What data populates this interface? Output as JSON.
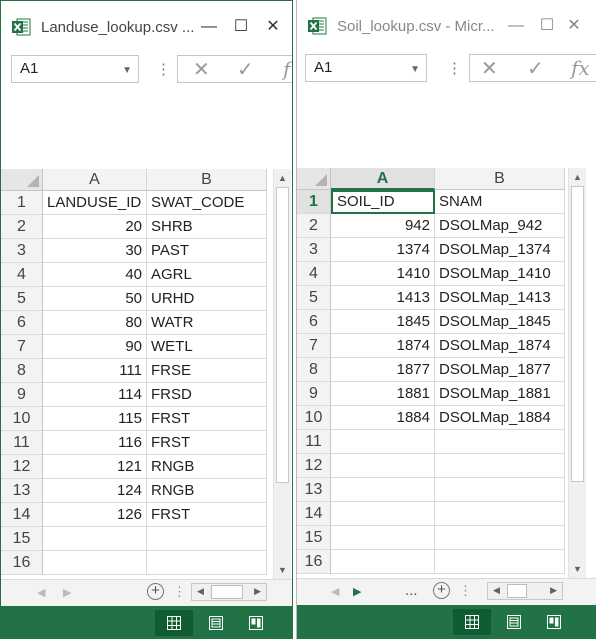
{
  "windows": [
    {
      "title": "Landuse_lookup.csv ...",
      "title_buttons": [
        "—",
        "☐",
        "✕"
      ],
      "namebox": "A1",
      "formula_icons": [
        "cancel-icon",
        "enter-icon",
        "function-icon"
      ],
      "formula_glyphs": [
        "✕",
        "✓",
        "f"
      ],
      "columns": [
        "A",
        "B"
      ],
      "row_numbers": [
        "1",
        "2",
        "3",
        "4",
        "5",
        "6",
        "7",
        "8",
        "9",
        "10",
        "11",
        "12",
        "13",
        "14",
        "15",
        "16"
      ],
      "cells": [
        [
          "LANDUSE_ID",
          "SWAT_CODE"
        ],
        [
          "20",
          "SHRB"
        ],
        [
          "30",
          "PAST"
        ],
        [
          "40",
          "AGRL"
        ],
        [
          "50",
          "URHD"
        ],
        [
          "80",
          "WATR"
        ],
        [
          "90",
          "WETL"
        ],
        [
          "111",
          "FRSE"
        ],
        [
          "114",
          "FRSD"
        ],
        [
          "115",
          "FRST"
        ],
        [
          "116",
          "FRST"
        ],
        [
          "121",
          "RNGB"
        ],
        [
          "124",
          "RNGB"
        ],
        [
          "126",
          "FRST"
        ],
        [
          "",
          ""
        ],
        [
          "",
          ""
        ]
      ],
      "active_cell": "A1",
      "status_views": [
        "normal-view-icon",
        "page-layout-view-icon",
        "page-break-preview-icon"
      ],
      "selected_view": "normal-view-icon"
    },
    {
      "title": "Soil_lookup.csv - Micr...",
      "title_buttons": [
        "—",
        "☐",
        "✕"
      ],
      "namebox": "A1",
      "formula_icons": [
        "cancel-icon",
        "enter-icon",
        "function-icon"
      ],
      "formula_glyphs": [
        "✕",
        "✓",
        "fx"
      ],
      "columns": [
        "A",
        "B"
      ],
      "row_numbers": [
        "1",
        "2",
        "3",
        "4",
        "5",
        "6",
        "7",
        "8",
        "9",
        "10",
        "11",
        "12",
        "13",
        "14",
        "15",
        "16"
      ],
      "cells": [
        [
          "SOIL_ID",
          "SNAM"
        ],
        [
          "942",
          "DSOLMap_942"
        ],
        [
          "1374",
          "DSOLMap_1374"
        ],
        [
          "1410",
          "DSOLMap_1410"
        ],
        [
          "1413",
          "DSOLMap_1413"
        ],
        [
          "1845",
          "DSOLMap_1845"
        ],
        [
          "1874",
          "DSOLMap_1874"
        ],
        [
          "1877",
          "DSOLMap_1877"
        ],
        [
          "1881",
          "DSOLMap_1881"
        ],
        [
          "1884",
          "DSOLMap_1884"
        ],
        [
          "",
          ""
        ],
        [
          "",
          ""
        ],
        [
          "",
          ""
        ],
        [
          "",
          ""
        ],
        [
          "",
          ""
        ],
        [
          "",
          ""
        ]
      ],
      "active_cell": "A1",
      "status_views": [
        "normal-view-icon",
        "page-layout-view-icon",
        "page-break-preview-icon"
      ],
      "selected_view": "normal-view-icon"
    }
  ],
  "tabbar_glyphs": {
    "ellipsis": "...",
    "plus": "+",
    "dots": "⋮"
  },
  "colors": {
    "excel_green": "#217346",
    "dark_green": "#0e5c2f",
    "grid_line": "#dadada",
    "header_bg": "#f3f3f3"
  }
}
